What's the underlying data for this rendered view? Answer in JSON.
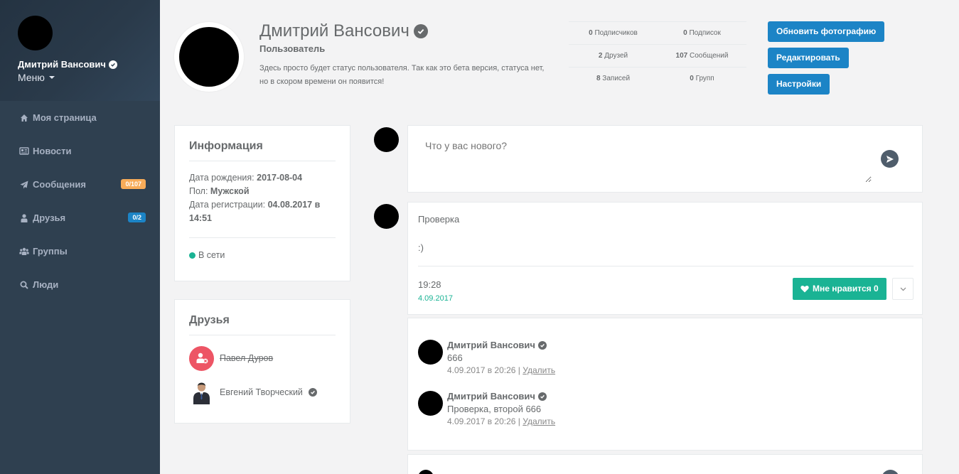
{
  "sidebar": {
    "user_name": "Дмитрий Вансович",
    "menu_label": "Меню",
    "items": [
      {
        "label": "Моя страница",
        "icon": "home-icon"
      },
      {
        "label": "Новости",
        "icon": "newspaper-icon"
      },
      {
        "label": "Сообщения",
        "icon": "paper-plane-icon",
        "badge": "0/107"
      },
      {
        "label": "Друзья",
        "icon": "user-icon",
        "badge": "0/2"
      },
      {
        "label": "Группы",
        "icon": "users-icon"
      },
      {
        "label": "Люди",
        "icon": "search-icon"
      }
    ]
  },
  "profile": {
    "name": "Дмитрий Вансович",
    "role": "Пользователь",
    "status": "Здесь просто будет статус пользователя. Так как это бета версия, статуса нет, но в скором времени он появится!"
  },
  "stats": [
    [
      {
        "value": "0",
        "label": "Подписчиков"
      },
      {
        "value": "0",
        "label": "Подписок"
      }
    ],
    [
      {
        "value": "2",
        "label": "Друзей"
      },
      {
        "value": "107",
        "label": "Сообщений"
      }
    ],
    [
      {
        "value": "8",
        "label": "Записей"
      },
      {
        "value": "0",
        "label": "Групп"
      }
    ]
  ],
  "actions": {
    "update_photo": "Обновить фотографию",
    "edit": "Редактировать",
    "settings": "Настройки"
  },
  "info": {
    "title": "Информация",
    "birth_label": "Дата рождения:",
    "birth_value": "2017-08-04",
    "gender_label": "Пол:",
    "gender_value": "Мужской",
    "reg_label": "Дата регистрации:",
    "reg_value": "04.08.2017 в 14:51",
    "online": "В сети"
  },
  "friends": {
    "title": "Друзья",
    "list": [
      {
        "name": "Павел Дуров"
      },
      {
        "name": "Евгений Творческий"
      }
    ]
  },
  "composer": {
    "placeholder": "Что у вас нового?"
  },
  "post": {
    "title": "Проверка",
    "body": ":)",
    "time": "19:28",
    "date": "4.09.2017",
    "like_label": "Мне нравится 0"
  },
  "comments": [
    {
      "author": "Дмитрий Вансович",
      "text": "666",
      "meta": "4.09.2017 в 20:26 |",
      "delete": "Удалить"
    },
    {
      "author": "Дмитрий Вансович",
      "text": "Проверка, второй 666",
      "meta": "4.09.2017 в 20:26 |",
      "delete": "Удалить"
    }
  ],
  "colors": {
    "sidebar": "#2f4050",
    "primary": "#1c84c6",
    "success": "#1ab394",
    "warning": "#f8ac59"
  }
}
